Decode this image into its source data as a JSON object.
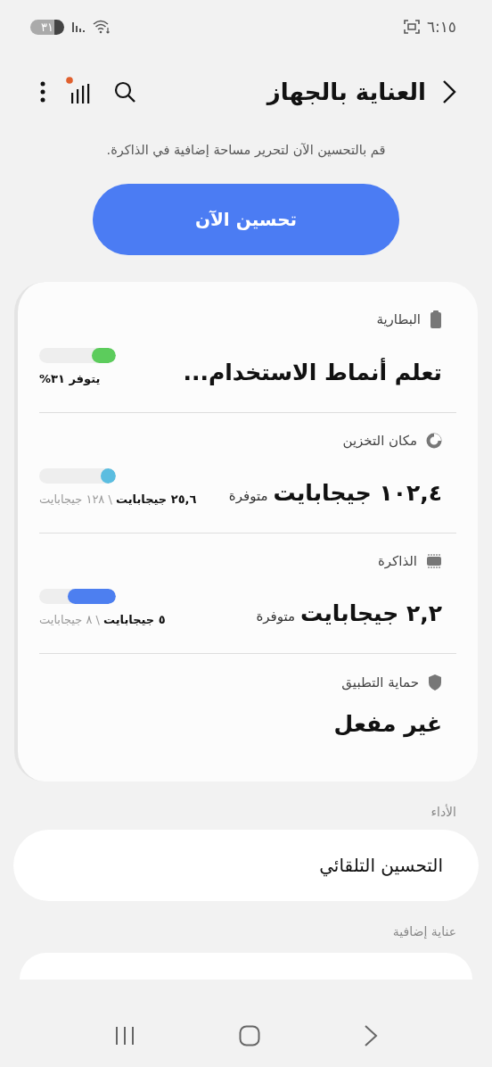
{
  "status_bar": {
    "time": "٦:١٥",
    "battery": "٣١"
  },
  "header": {
    "title": "العناية بالجهاز",
    "notification_dot": true
  },
  "subtitle": "قم بالتحسين الآن لتحرير مساحة إضافية في الذاكرة.",
  "optimize_button": "تحسين الآن",
  "items": [
    {
      "kind": "battery",
      "label": "البطارية",
      "value": "تعلم أنماط الاستخدام...",
      "meter": {
        "level": 0.31,
        "color": "#5ccc5c",
        "used": "يتوفر ٣١%"
      }
    },
    {
      "kind": "storage",
      "label": "مكان التخزين",
      "value": "١٠٢,٤ جيجابايت",
      "suffix": "متوفرة",
      "meter": {
        "level": 0.2,
        "color": "#5bbde0",
        "used": "٢٥,٦ جيجابايت",
        "total": "\\ ١٢٨ جيجابايت"
      }
    },
    {
      "kind": "memory",
      "label": "الذاكرة",
      "value": "٢,٢ جيجابايت",
      "suffix": "متوفرة",
      "meter": {
        "level": 0.625,
        "color": "#4d7ff0",
        "used": "٥ جيجابايت",
        "total": "\\ ٨ جيجابايت"
      }
    },
    {
      "kind": "protection",
      "label": "حماية التطبيق",
      "value": "غير مفعل"
    }
  ],
  "sections": [
    {
      "title": "الأداء",
      "rows": [
        "التحسين التلقائي"
      ]
    },
    {
      "title": "عناية إضافية"
    }
  ]
}
